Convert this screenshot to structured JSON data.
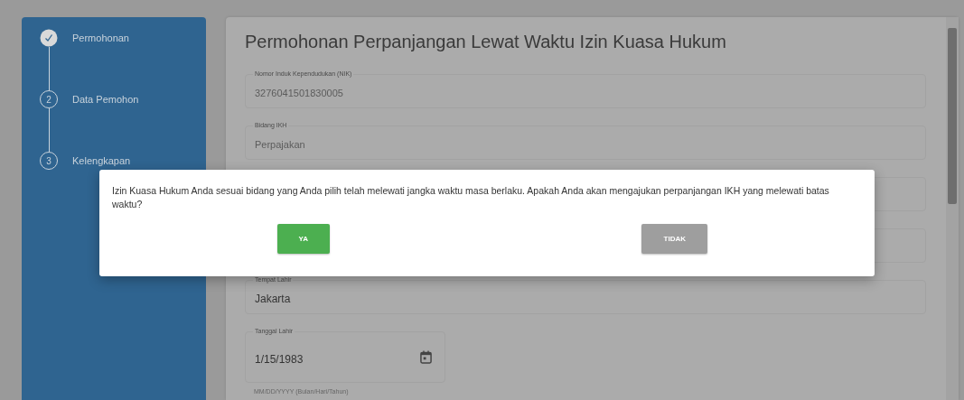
{
  "steps": [
    {
      "label": "Permohonan",
      "completed": true
    },
    {
      "number": "2",
      "label": "Data Pemohon",
      "completed": false
    },
    {
      "number": "3",
      "label": "Kelengkapan",
      "completed": false
    }
  ],
  "form": {
    "title": "Permohonan Perpanjangan Lewat Waktu Izin Kuasa Hukum",
    "fields": [
      {
        "kind": "text",
        "label": "Nomor Induk Kependudukan (NIK)",
        "value": "3276041501830005",
        "disabled": true
      },
      {
        "kind": "text",
        "label": "Bidang IKH",
        "value": "Perpajakan",
        "disabled": true
      },
      {
        "kind": "text"
      },
      {
        "kind": "text"
      },
      {
        "kind": "text",
        "label": "Tempat Lahir",
        "value": "Jakarta",
        "disabled": false
      },
      {
        "kind": "date",
        "label": "Tanggal Lahir",
        "value": "1/15/1983",
        "helper": "MM/DD/YYYY (Bulan/Hari/Tahun)"
      }
    ]
  },
  "dialog": {
    "message": "Izin Kuasa Hukum Anda sesuai bidang yang Anda pilih telah melewati jangka waktu masa berlaku. Apakah Anda akan mengajukan perpanjangan IKH yang melewati batas waktu?",
    "buttons": [
      {
        "label": "YA",
        "kind": "primary"
      },
      {
        "label": "TIDAK",
        "kind": "secondary"
      }
    ]
  }
}
